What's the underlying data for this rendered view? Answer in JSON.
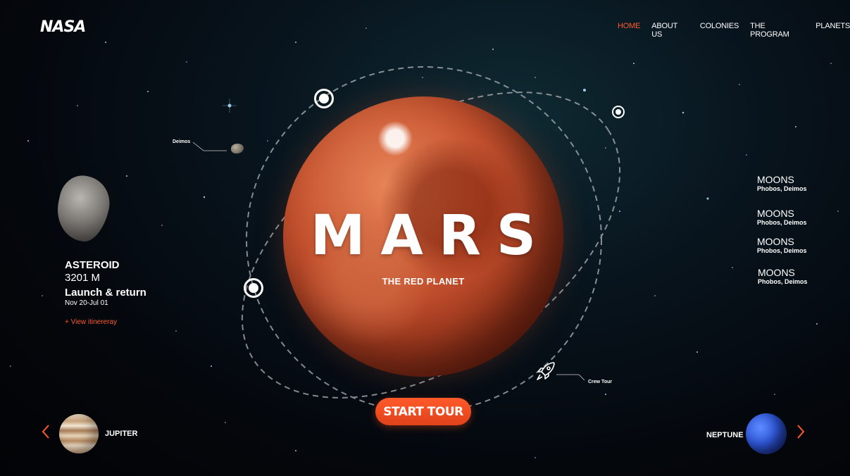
{
  "brand": {
    "logo_text": "NASA"
  },
  "nav": {
    "items": [
      "HOME",
      "ABOUT US",
      "COLONIES",
      "THE PROGRAM",
      "PLANETS"
    ],
    "active_index": 0
  },
  "hero": {
    "title": "MARS",
    "subtitle": "THE RED PLANET",
    "cta_label": "START TOUR"
  },
  "labels": {
    "deimos": "Deimos",
    "crew_tour": "Crew Tour"
  },
  "asteroid": {
    "title": "ASTEROID",
    "distance": "3201 M",
    "launch": "Launch & return",
    "dates": "Nov 20-Jul 01",
    "link": "+ View itinereray"
  },
  "moons": [
    {
      "heading": "MOONS",
      "names": "Phobos, Deimos"
    },
    {
      "heading": "MOONS",
      "names": "Phobos, Deimos"
    },
    {
      "heading": "MOONS",
      "names": "Phobos, Deimos"
    },
    {
      "heading": "MOONS",
      "names": "Phobos, Deimos"
    }
  ],
  "navigation_planets": {
    "previous": "JUPITER",
    "next": "NEPTUNE"
  },
  "colors": {
    "accent": "#ff5a2a",
    "background": "#04070c",
    "text": "#ffffff"
  },
  "icons": [
    "chevron-left-icon",
    "chevron-right-icon",
    "rocket-icon"
  ]
}
